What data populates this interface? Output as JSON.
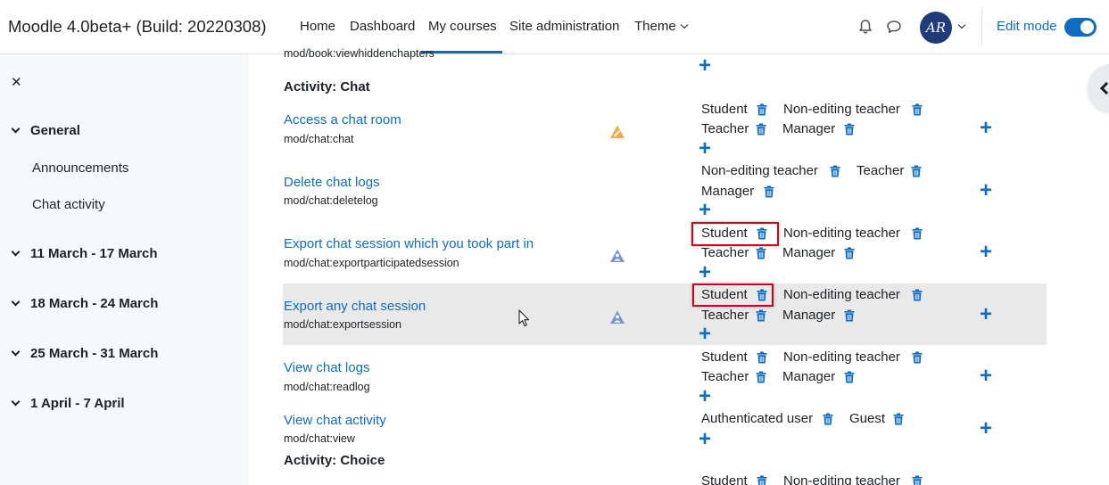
{
  "navbar": {
    "brand": "Moodle 4.0beta+ (Build: 20220308)",
    "links": [
      "Home",
      "Dashboard",
      "My courses",
      "Site administration",
      "Theme"
    ],
    "avatar_initials": "AR",
    "edit_mode_label": "Edit mode",
    "edit_mode_on": true,
    "accent_color": "#0f6cbf"
  },
  "drawer": {
    "close_symbol": "✕",
    "sections": [
      "General",
      "11 March - 17 March",
      "18 March - 24 March",
      "25 March - 31 March",
      "1 April - 7 April"
    ],
    "general_activities": [
      "Announcements",
      "Chat activity"
    ]
  },
  "main": {
    "cut_capability": "mod/book:viewhiddenchapters",
    "heading_chat": "Activity: Chat",
    "heading_choice": "Activity: Choice",
    "capabilities": [
      {
        "label": "Access a chat room",
        "name": "mod/chat:chat",
        "risk": "warning-icon",
        "roles": [
          "Student",
          "Non-editing teacher",
          "Teacher",
          "Manager"
        ]
      },
      {
        "label": "Delete chat logs",
        "name": "mod/chat:deletelog",
        "roles": [
          "Non-editing teacher",
          "Teacher",
          "Manager"
        ]
      },
      {
        "label": "Export chat session which you took part in",
        "name": "mod/chat:exportparticipatedsession",
        "risk": "personal-data-icon",
        "roles": [
          "Student",
          "Non-editing teacher",
          "Teacher",
          "Manager"
        ]
      },
      {
        "label": "Export any chat session",
        "name": "mod/chat:exportsession",
        "risk": "personal-data-icon",
        "roles": [
          "Student",
          "Non-editing teacher",
          "Teacher",
          "Manager"
        ]
      },
      {
        "label": "View chat logs",
        "name": "mod/chat:readlog",
        "roles": [
          "Student",
          "Non-editing teacher",
          "Teacher",
          "Manager"
        ]
      },
      {
        "label": "View chat activity",
        "name": "mod/chat:view",
        "roles": [
          "Authenticated user",
          "Guest"
        ]
      }
    ],
    "partial_roles": [
      "Student",
      "Non-editing teacher"
    ],
    "add_symbol": "+"
  }
}
